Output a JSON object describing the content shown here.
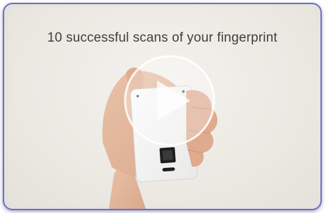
{
  "video": {
    "caption": "10 successful scans of your fingerprint",
    "play_button_icon": "play-icon",
    "card_icon": "fingerprint-sensor-icon"
  },
  "colors": {
    "frame_border": "#6b6fc6",
    "background": "#ece9e3",
    "card": "#f7f7f6",
    "sensor": "#2a2a2a",
    "play_overlay": "#ffffff"
  }
}
